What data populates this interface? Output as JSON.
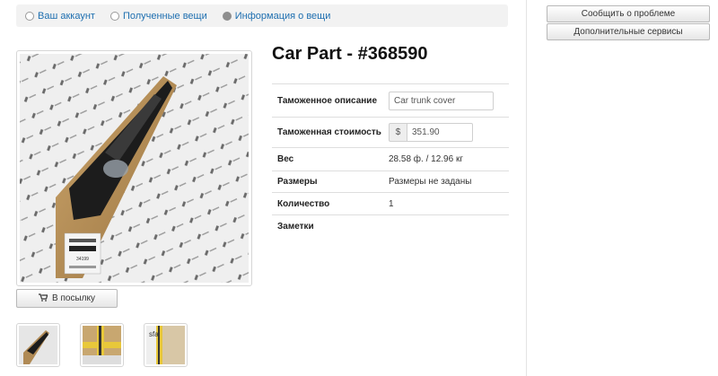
{
  "tabs": [
    {
      "label": "Ваш аккаунт",
      "checked": false
    },
    {
      "label": "Полученные вещи",
      "checked": false
    },
    {
      "label": "Информация о вещи",
      "checked": true
    }
  ],
  "sidebar": {
    "report_problem": "Сообщить о проблеме",
    "extra_services": "Дополнительные сервисы"
  },
  "item": {
    "title": "Car Part - #368590",
    "add_to_parcel": "В посылку",
    "photo_label": "34199"
  },
  "details": {
    "customs_description_label": "Таможенное описание",
    "customs_description_value": "Car trunk cover",
    "customs_value_label": "Таможенная стоимость",
    "currency_symbol": "$",
    "customs_value_value": "351.90",
    "weight_label": "Вес",
    "weight_value": "28.58 ф. / 12.96 кг",
    "size_label": "Размеры",
    "size_value": "Размеры не заданы",
    "quantity_label": "Количество",
    "quantity_value": "1",
    "notes_label": "Заметки"
  },
  "colors": {
    "link": "#1e6fb0",
    "tab_bg": "#f2f2f2"
  }
}
